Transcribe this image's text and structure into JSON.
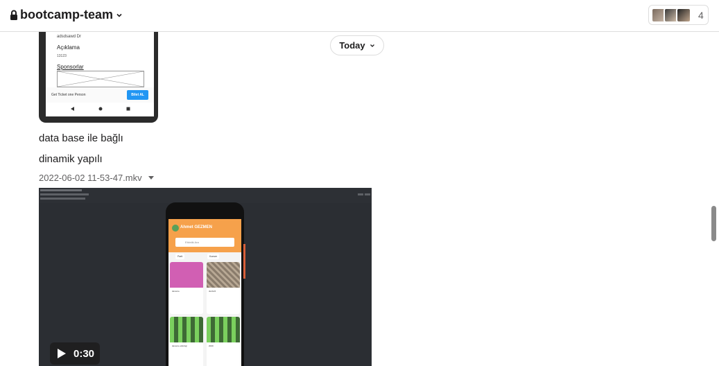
{
  "header": {
    "channel_name": "bootcamp-team",
    "member_count": "4"
  },
  "divider": {
    "today_label": "Today"
  },
  "thumbnail_phone": {
    "id_text": "adsdsawd Dr",
    "label_aciklama": "Açıklama",
    "aciklama_value": "13123",
    "label_sponsorlar": "Sponsorlar",
    "ticket_text": "Get Ticket one Person",
    "buy_button": "Bilet AL"
  },
  "messages": [
    {
      "text": "data base ile bağlı"
    },
    {
      "text": "dinamik yapılı"
    }
  ],
  "file": {
    "name": "2022-06-02 11-53-47.mkv"
  },
  "video": {
    "duration": "0:30",
    "app_user": "Ahmet GEZMEN",
    "search_placeholder": "Etkinlik Ara",
    "chips": [
      "Parti",
      "Konser"
    ],
    "cards": [
      "deneme",
      "durdurtl",
      "deneme etkinlıgi",
      "2020"
    ]
  },
  "colors": {
    "accent": "#f6a14b",
    "card_pink": "#d15fb3",
    "buy_blue": "#2196f3"
  }
}
